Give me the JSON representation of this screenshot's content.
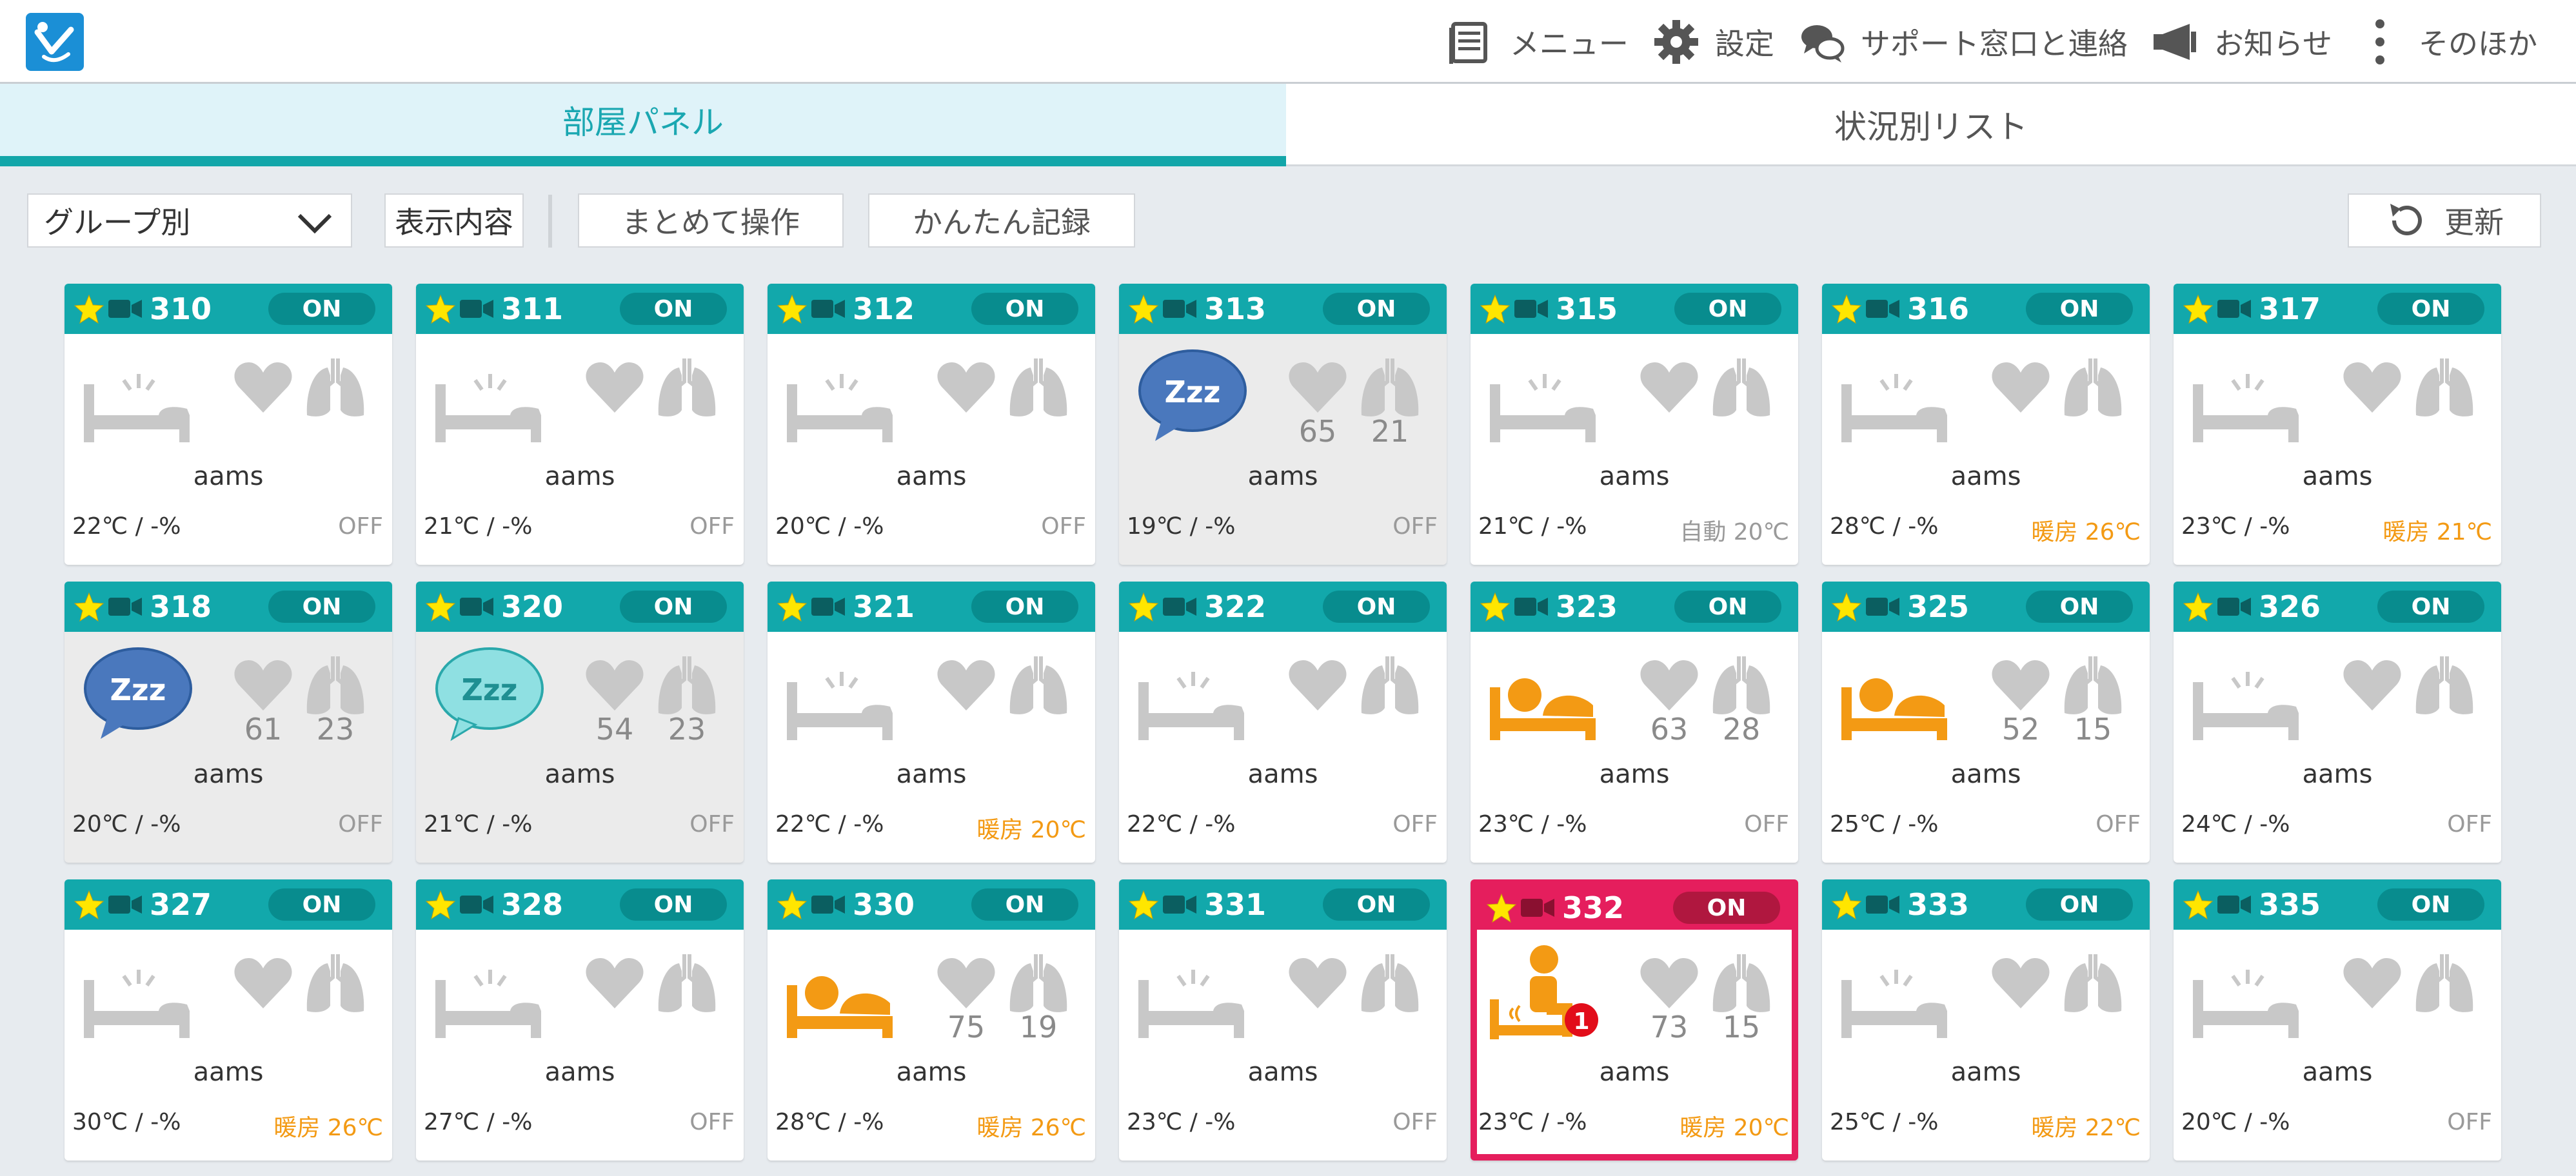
{
  "header": {
    "nav": [
      {
        "id": "menu",
        "label": "メニュー",
        "icon": "menu-list-icon"
      },
      {
        "id": "settings",
        "label": "設定",
        "icon": "gear-icon"
      },
      {
        "id": "support",
        "label": "サポート窓口と連絡",
        "icon": "chat-bubbles-icon"
      },
      {
        "id": "news",
        "label": "お知らせ",
        "icon": "megaphone-icon"
      },
      {
        "id": "other",
        "label": "そのほか",
        "icon": "kebab-menu-icon"
      }
    ]
  },
  "tabs": {
    "room_panel": "部屋パネル",
    "status_list": "状況別リスト"
  },
  "toolbar": {
    "group_select": "グループ別",
    "display": "表示内容",
    "bulk": "まとめて操作",
    "quick": "かんたん記録",
    "refresh": "更新"
  },
  "colors": {
    "teal": "#12a8ab",
    "alert": "#e51e5d",
    "orange": "#f39a14",
    "gray_icon": "#c8c8c8"
  },
  "rooms": [
    {
      "no": "310",
      "on": "ON",
      "name": "aams",
      "temp": "22℃ / -%",
      "ac": "OFF",
      "status": "empty",
      "hr": "",
      "rr": ""
    },
    {
      "no": "311",
      "on": "ON",
      "name": "aams",
      "temp": "21℃ / -%",
      "ac": "OFF",
      "status": "empty",
      "hr": "",
      "rr": ""
    },
    {
      "no": "312",
      "on": "ON",
      "name": "aams",
      "temp": "20℃ / -%",
      "ac": "OFF",
      "status": "empty",
      "hr": "",
      "rr": ""
    },
    {
      "no": "313",
      "on": "ON",
      "name": "aams",
      "temp": "19℃ / -%",
      "ac": "OFF",
      "status": "sleep-deep",
      "hr": "65",
      "rr": "21"
    },
    {
      "no": "315",
      "on": "ON",
      "name": "aams",
      "temp": "21℃ / -%",
      "ac": "自動 20℃",
      "status": "empty",
      "hr": "",
      "rr": ""
    },
    {
      "no": "316",
      "on": "ON",
      "name": "aams",
      "temp": "28℃ / -%",
      "ac": "暖房 26℃",
      "status": "empty",
      "hr": "",
      "rr": ""
    },
    {
      "no": "317",
      "on": "ON",
      "name": "aams",
      "temp": "23℃ / -%",
      "ac": "暖房 21℃",
      "status": "empty",
      "hr": "",
      "rr": ""
    },
    {
      "no": "318",
      "on": "ON",
      "name": "aams",
      "temp": "20℃ / -%",
      "ac": "OFF",
      "status": "sleep-deep",
      "hr": "61",
      "rr": "23"
    },
    {
      "no": "320",
      "on": "ON",
      "name": "aams",
      "temp": "21℃ / -%",
      "ac": "OFF",
      "status": "sleep-light",
      "hr": "54",
      "rr": "23"
    },
    {
      "no": "321",
      "on": "ON",
      "name": "aams",
      "temp": "22℃ / -%",
      "ac": "暖房 20℃",
      "status": "empty",
      "hr": "",
      "rr": ""
    },
    {
      "no": "322",
      "on": "ON",
      "name": "aams",
      "temp": "22℃ / -%",
      "ac": "OFF",
      "status": "empty",
      "hr": "",
      "rr": ""
    },
    {
      "no": "323",
      "on": "ON",
      "name": "aams",
      "temp": "23℃ / -%",
      "ac": "OFF",
      "status": "in-bed",
      "hr": "63",
      "rr": "28"
    },
    {
      "no": "325",
      "on": "ON",
      "name": "aams",
      "temp": "25℃ / -%",
      "ac": "OFF",
      "status": "in-bed",
      "hr": "52",
      "rr": "15"
    },
    {
      "no": "326",
      "on": "ON",
      "name": "aams",
      "temp": "24℃ / -%",
      "ac": "OFF",
      "status": "empty",
      "hr": "",
      "rr": ""
    },
    {
      "no": "327",
      "on": "ON",
      "name": "aams",
      "temp": "30℃ / -%",
      "ac": "暖房 26℃",
      "status": "empty",
      "hr": "",
      "rr": ""
    },
    {
      "no": "328",
      "on": "ON",
      "name": "aams",
      "temp": "27℃ / -%",
      "ac": "OFF",
      "status": "empty",
      "hr": "",
      "rr": ""
    },
    {
      "no": "330",
      "on": "ON",
      "name": "aams",
      "temp": "28℃ / -%",
      "ac": "暖房 26℃",
      "status": "in-bed",
      "hr": "75",
      "rr": "19"
    },
    {
      "no": "331",
      "on": "ON",
      "name": "aams",
      "temp": "23℃ / -%",
      "ac": "OFF",
      "status": "empty",
      "hr": "",
      "rr": ""
    },
    {
      "no": "332",
      "on": "ON",
      "name": "aams",
      "temp": "23℃ / -%",
      "ac": "暖房 20℃",
      "status": "sitting-alert",
      "hr": "73",
      "rr": "15",
      "alert_count": "1"
    },
    {
      "no": "333",
      "on": "ON",
      "name": "aams",
      "temp": "25℃ / -%",
      "ac": "暖房 22℃",
      "status": "empty",
      "hr": "",
      "rr": ""
    },
    {
      "no": "335",
      "on": "ON",
      "name": "aams",
      "temp": "20℃ / -%",
      "ac": "OFF",
      "status": "empty",
      "hr": "",
      "rr": ""
    }
  ]
}
